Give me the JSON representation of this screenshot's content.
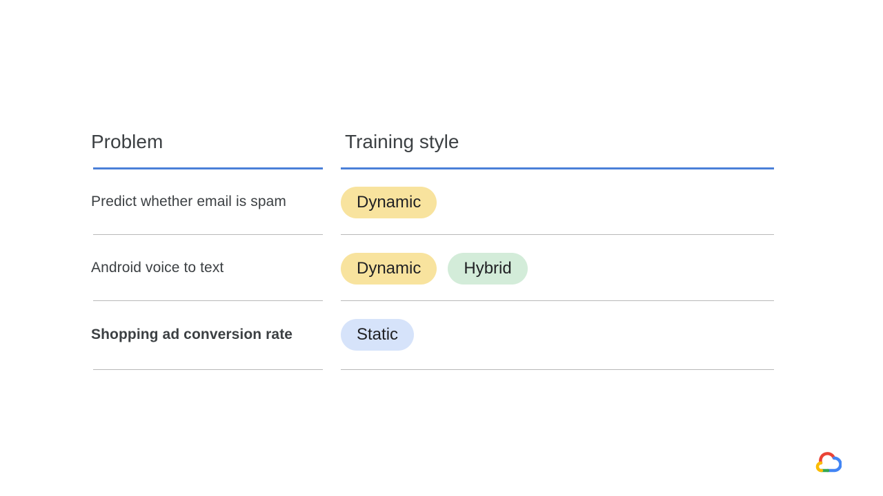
{
  "table": {
    "headers": {
      "problem": "Problem",
      "training_style": "Training style"
    },
    "rows": [
      {
        "problem": "Predict whether email is spam",
        "emphasis": false,
        "tags": [
          {
            "label": "Dynamic",
            "color": "#f8e39e"
          }
        ]
      },
      {
        "problem": "Android voice to text",
        "emphasis": false,
        "tags": [
          {
            "label": "Dynamic",
            "color": "#f8e39e"
          },
          {
            "label": "Hybrid",
            "color": "#d3ecd9"
          }
        ]
      },
      {
        "problem": "Shopping ad conversion rate",
        "emphasis": true,
        "tags": [
          {
            "label": "Static",
            "color": "#d6e3fa"
          }
        ]
      }
    ]
  },
  "colors": {
    "header_rule": "#4a7fd8",
    "row_rule": "#b8b8b8",
    "text": "#3c4043"
  },
  "logo": {
    "icon": "google-cloud-logo-icon",
    "colors": [
      "#ea4335",
      "#fbbc04",
      "#34a853",
      "#4285f4"
    ]
  }
}
